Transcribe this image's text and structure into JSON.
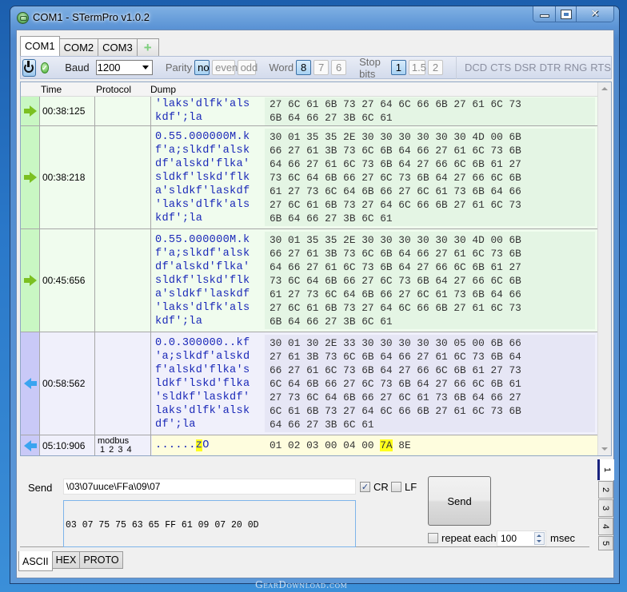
{
  "window": {
    "title": "COM1 - STermPro v1.0.2",
    "controls": {
      "minimize": "minimize",
      "maximize": "maximize",
      "close": "✕"
    }
  },
  "port_tabs": [
    {
      "label": "COM1",
      "active": true
    },
    {
      "label": "COM2",
      "active": false
    },
    {
      "label": "COM3",
      "active": false
    },
    {
      "label": "+",
      "active": false,
      "icon": "add-icon"
    }
  ],
  "toolbar": {
    "power_icon": "power-icon",
    "status_icon": "connected-check-icon",
    "status_glyph": "✓",
    "baud_label": "Baud",
    "baud_value": "1200",
    "parity_label": "Parity",
    "parity_options": [
      {
        "label": "no",
        "active": true
      },
      {
        "label": "even",
        "active": false
      },
      {
        "label": "odd",
        "active": false
      }
    ],
    "word_label": "Word",
    "word_options": [
      {
        "label": "8",
        "active": true
      },
      {
        "label": "7",
        "active": false
      },
      {
        "label": "6",
        "active": false
      }
    ],
    "stop_label": "Stop bits",
    "stop_options": [
      {
        "label": "1",
        "active": true
      },
      {
        "label": "1.5",
        "active": false
      },
      {
        "label": "2",
        "active": false
      }
    ],
    "signals": [
      "DCD",
      "CTS",
      "DSR",
      "DTR",
      "RNG",
      "RTS"
    ]
  },
  "grid": {
    "columns": {
      "time": "Time",
      "protocol": "Protocol",
      "dump": "Dump"
    },
    "rows": [
      {
        "direction": "out",
        "time": "00:38:125",
        "protocol": "",
        "ascii": "'laks'dlfk'als\nkdf';la",
        "hex": "27 6C 61 6B 73 27 64 6C 66 6B 27 61 6C 73\n6B 64 66 27 3B 6C 61"
      },
      {
        "direction": "out",
        "time": "00:38:218",
        "protocol": "",
        "ascii": "0.55.000000M.k\nf'a;slkdf'alsk\ndf'alskd'flka'\nsldkf'lskd'flk\na'sldkf'laskdf\n'laks'dlfk'als\nkdf';la",
        "hex": "30 01 35 35 2E 30 30 30 30 30 30 4D 00 6B\n66 27 61 3B 73 6C 6B 64 66 27 61 6C 73 6B\n64 66 27 61 6C 73 6B 64 27 66 6C 6B 61 27\n73 6C 64 6B 66 27 6C 73 6B 64 27 66 6C 6B\n61 27 73 6C 64 6B 66 27 6C 61 73 6B 64 66\n27 6C 61 6B 73 27 64 6C 66 6B 27 61 6C 73\n6B 64 66 27 3B 6C 61"
      },
      {
        "direction": "out",
        "time": "00:45:656",
        "protocol": "",
        "ascii": "0.55.000000M.k\nf'a;slkdf'alsk\ndf'alskd'flka'\nsldkf'lskd'flk\na'sldkf'laskdf\n'laks'dlfk'als\nkdf';la",
        "hex": "30 01 35 35 2E 30 30 30 30 30 30 4D 00 6B\n66 27 61 3B 73 6C 6B 64 66 27 61 6C 73 6B\n64 66 27 61 6C 73 6B 64 27 66 6C 6B 61 27\n73 6C 64 6B 66 27 6C 73 6B 64 27 66 6C 6B\n61 27 73 6C 64 6B 66 27 6C 61 73 6B 64 66\n27 6C 61 6B 73 27 64 6C 66 6B 27 61 6C 73\n6B 64 66 27 3B 6C 61"
      },
      {
        "direction": "in",
        "time": "00:58:562",
        "protocol": "",
        "ascii": "0.0.300000..kf\n'a;slkdf'alskd\nf'alskd'flka's\nldkf'lskd'flka\n'sldkf'laskdf'\nlaks'dlfk'alsk\ndf';la",
        "hex": "30 01 30 2E 33 30 30 30 30 30 05 00 6B 66\n27 61 3B 73 6C 6B 64 66 27 61 6C 73 6B 64\n66 27 61 6C 73 6B 64 27 66 6C 6B 61 27 73\n6C 64 6B 66 27 6C 73 6B 64 27 66 6C 6B 61\n27 73 6C 64 6B 66 27 6C 61 73 6B 64 66 27\n6C 61 6B 73 27 64 6C 66 6B 27 61 6C 73 6B\n64 66 27 3B 6C 61"
      },
      {
        "direction": "in",
        "time": "05:10:906",
        "protocol": "modbus",
        "protocol_sub": "1 2 3 4",
        "ascii_pre": "......",
        "ascii_mark": "z",
        "ascii_post": "O",
        "hex_pre": "01 02 03 00 04 00 ",
        "hex_mark": "7A",
        "hex_post": " 8E"
      }
    ]
  },
  "send": {
    "label": "Send",
    "input_value": "\\03\\07uuce\\FFa\\09\\07",
    "cr_label": "CR",
    "cr_checked": true,
    "lf_label": "LF",
    "lf_checked": false,
    "hex_preview": "03 07 75 75 63 65 FF 61 09 07 20 0D",
    "send_button": "Send",
    "repeat_label": "repeat each",
    "repeat_checked": false,
    "repeat_value": "100",
    "repeat_unit": "msec"
  },
  "side_tabs": [
    "1",
    "2",
    "3",
    "4",
    "5"
  ],
  "bottom_tabs": [
    {
      "label": "ASCII",
      "active": true
    },
    {
      "label": "HEX",
      "active": false
    },
    {
      "label": "PROTO",
      "active": false
    }
  ],
  "watermark": "GearDownload.com"
}
